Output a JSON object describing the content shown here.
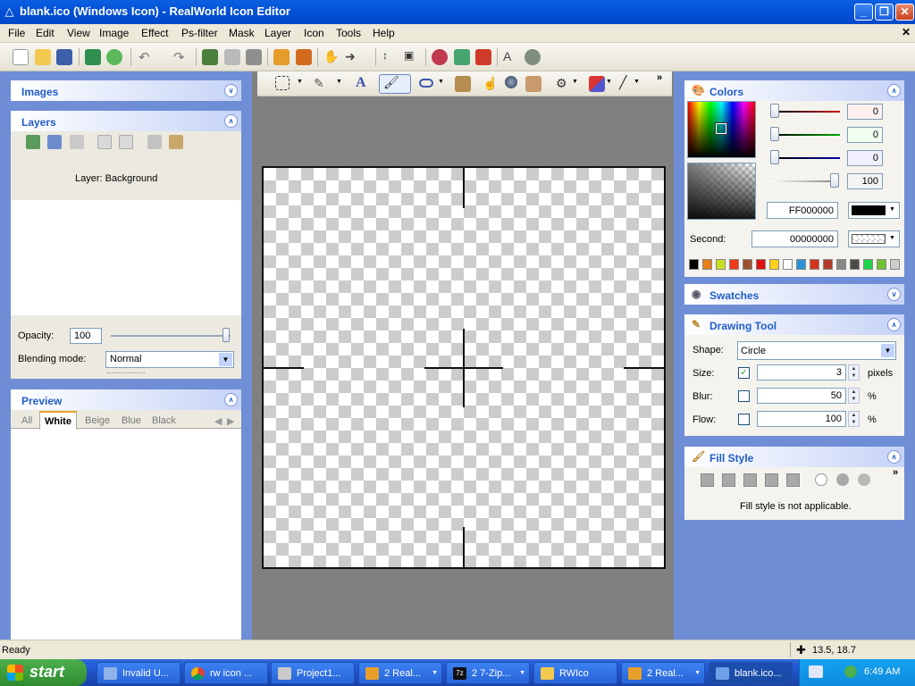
{
  "window": {
    "title": "blank.ico (Windows Icon) - RealWorld Icon Editor"
  },
  "menu": [
    "File",
    "Edit",
    "View",
    "Image",
    "Effect",
    "Ps-filter",
    "Mask",
    "Layer",
    "Icon",
    "Tools",
    "Help"
  ],
  "panels": {
    "images": {
      "title": "Images"
    },
    "layers": {
      "title": "Layers",
      "layer_name": "Layer: Background",
      "opacity_label": "Opacity:",
      "opacity_value": "100",
      "blend_label": "Blending mode:",
      "blend_value": "Normal"
    },
    "preview": {
      "title": "Preview",
      "tabs": [
        "All",
        "White",
        "Beige",
        "Blue",
        "Black"
      ],
      "active_tab": "White"
    },
    "colors": {
      "title": "Colors",
      "r": "0",
      "g": "0",
      "b": "0",
      "alpha": "100",
      "primary_hex": "FF000000",
      "second_label": "Second:",
      "second_hex": "00000000",
      "palette": [
        "#000000",
        "#e87e1a",
        "#c9e021",
        "#ee3b1b",
        "#a0522d",
        "#e01010",
        "#ffd21a",
        "#ffffff",
        "#2a93d5",
        "#d4341f",
        "#b33a2a",
        "#888888",
        "#4b4b4b",
        "#1fd44a",
        "#6fc232",
        "#cccccc"
      ]
    },
    "swatches": {
      "title": "Swatches"
    },
    "drawing_tool": {
      "title": "Drawing Tool",
      "shape_label": "Shape:",
      "shape_value": "Circle",
      "size_label": "Size:",
      "size_value": "3",
      "size_unit": "pixels",
      "size_checked": true,
      "blur_label": "Blur:",
      "blur_value": "50",
      "blur_unit": "%",
      "flow_label": "Flow:",
      "flow_value": "100",
      "flow_unit": "%"
    },
    "fill_style": {
      "title": "Fill Style",
      "message": "Fill style is not applicable."
    }
  },
  "status": {
    "text": "Ready",
    "coords": "13.5, 18.7"
  },
  "taskbar": {
    "start": "start",
    "tasks": [
      "Invalid U...",
      "rw icon ...",
      "Project1...",
      "2 Real...",
      "2 7-Zip...",
      "RWIco",
      "2 Real...",
      "blank.ico..."
    ],
    "clock": "6:49 AM"
  }
}
